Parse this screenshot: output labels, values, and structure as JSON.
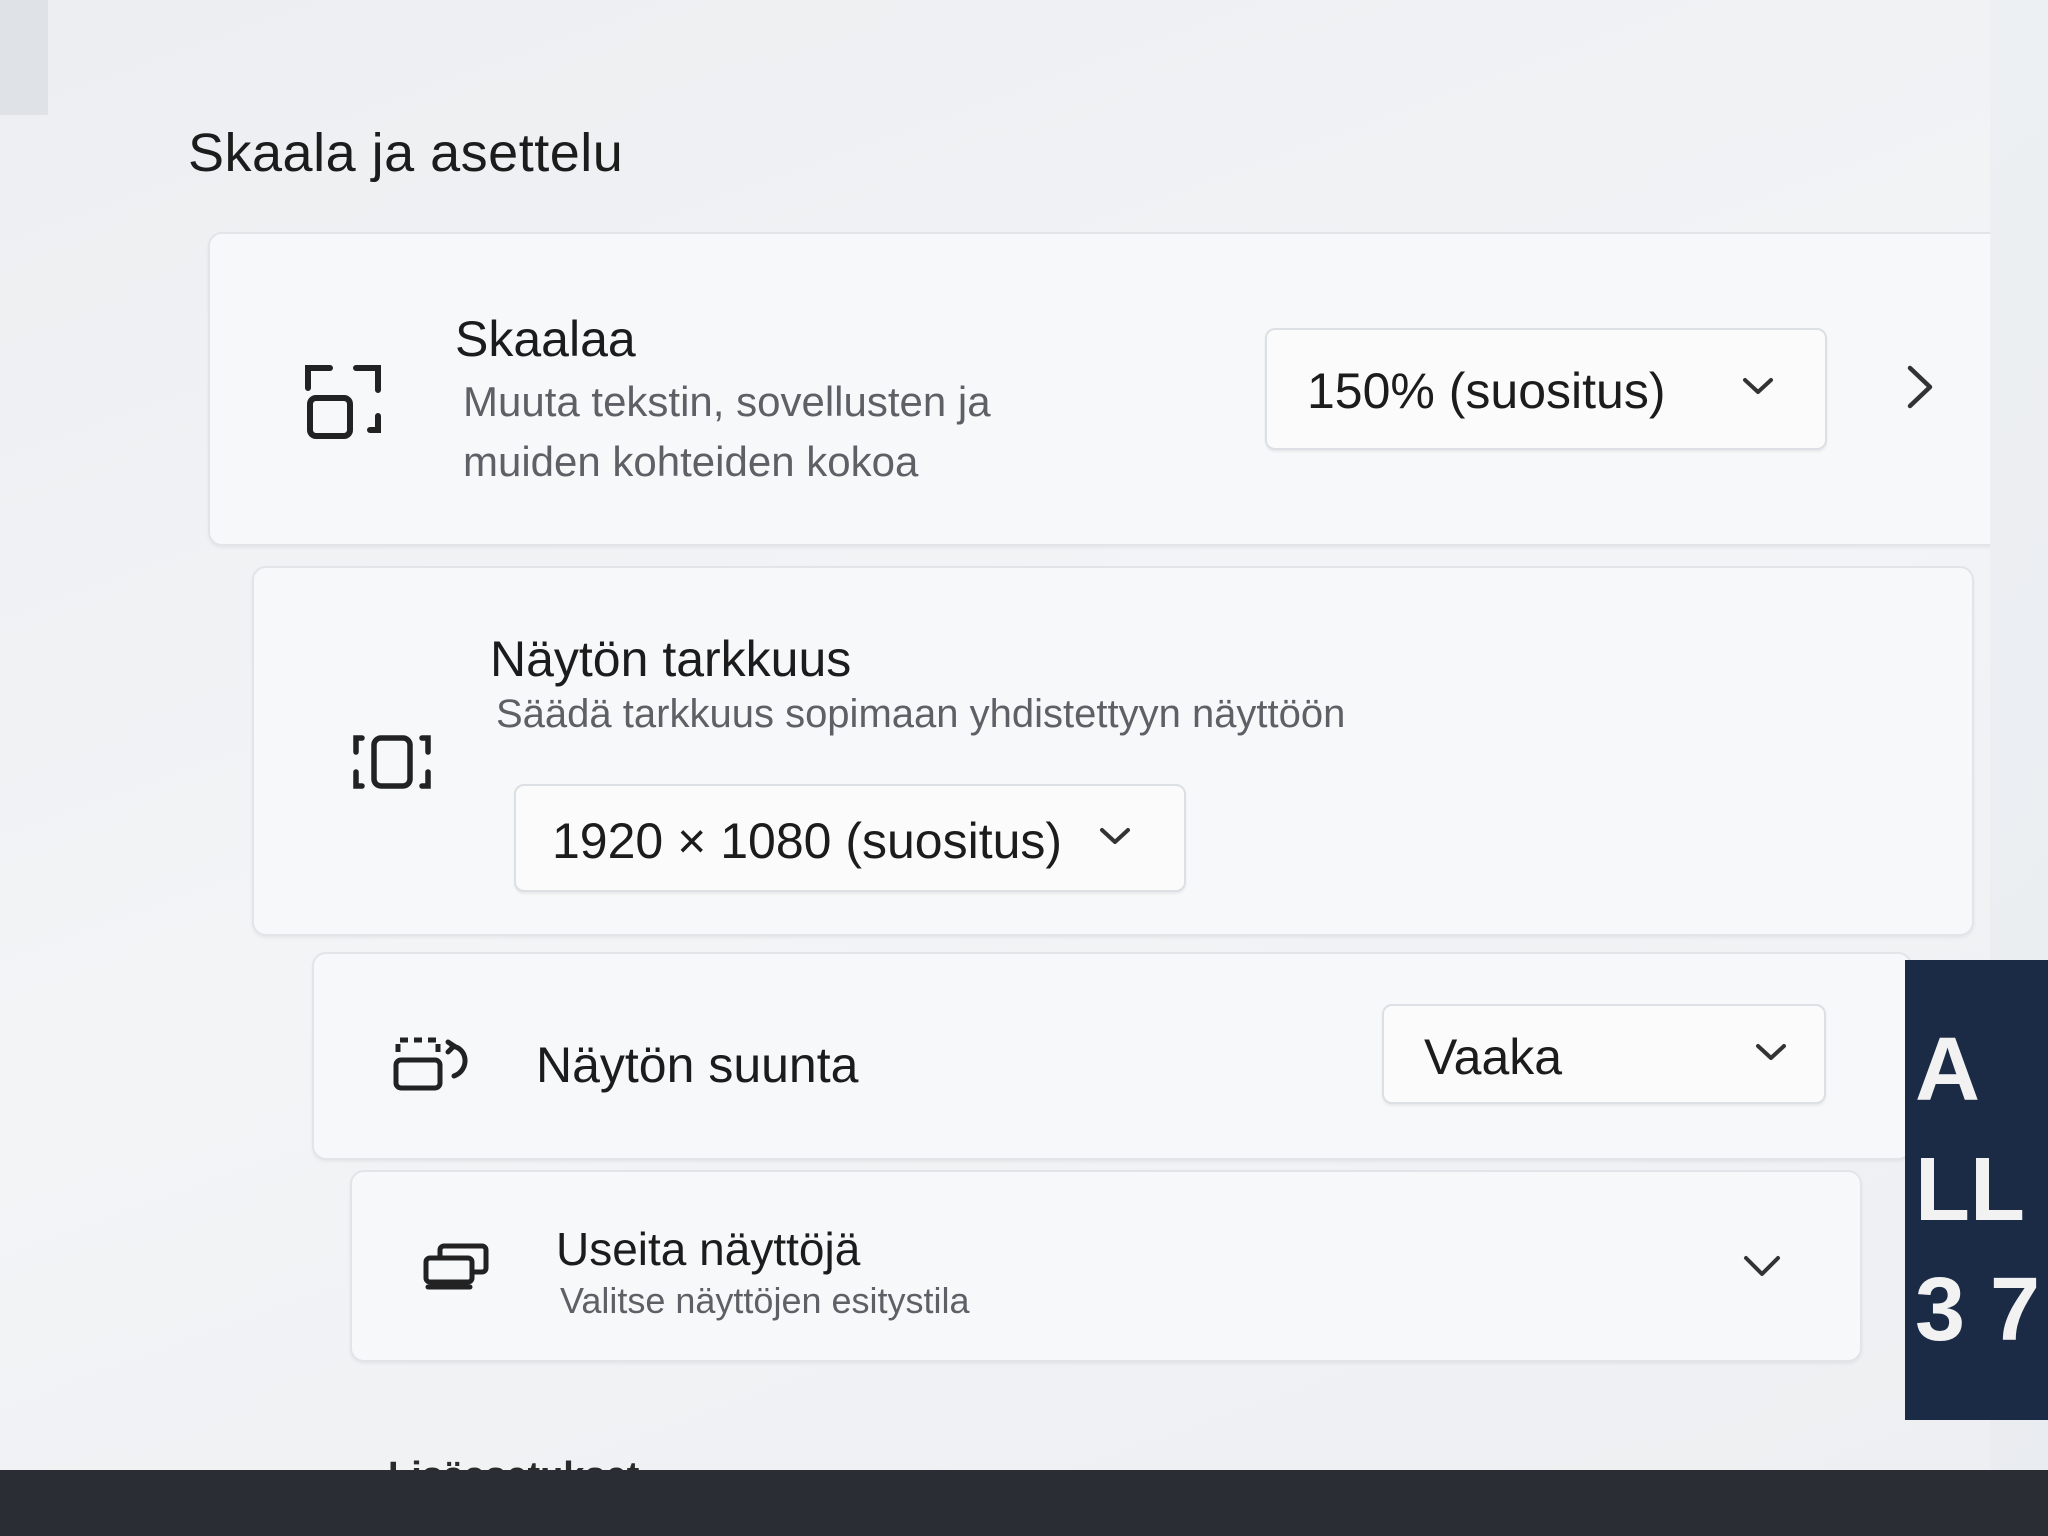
{
  "section_title": "Skaala ja asettelu",
  "scale": {
    "title": "Skaalaa",
    "description": "Muuta tekstin, sovellusten ja muiden kohteiden kokoa",
    "value": "150% (suositus)",
    "icon": "scale-icon",
    "chevron": "chevron-right-icon"
  },
  "resolution": {
    "title": "Näytön tarkkuus",
    "description": "Säädä tarkkuus sopimaan yhdistettyyn näyttöön",
    "value": "1920 × 1080 (suositus)",
    "icon": "resolution-icon"
  },
  "orientation": {
    "title": "Näytön suunta",
    "value": "Vaaka",
    "icon": "orientation-icon"
  },
  "multiple_displays": {
    "title": "Useita näyttöjä",
    "description": "Valitse näyttöjen esitystila",
    "icon": "multiple-displays-icon"
  },
  "footer": {
    "label": "Lisäasetukset"
  },
  "background_letters": {
    "line1": "A",
    "line2": "LL",
    "line3": "3 7"
  }
}
